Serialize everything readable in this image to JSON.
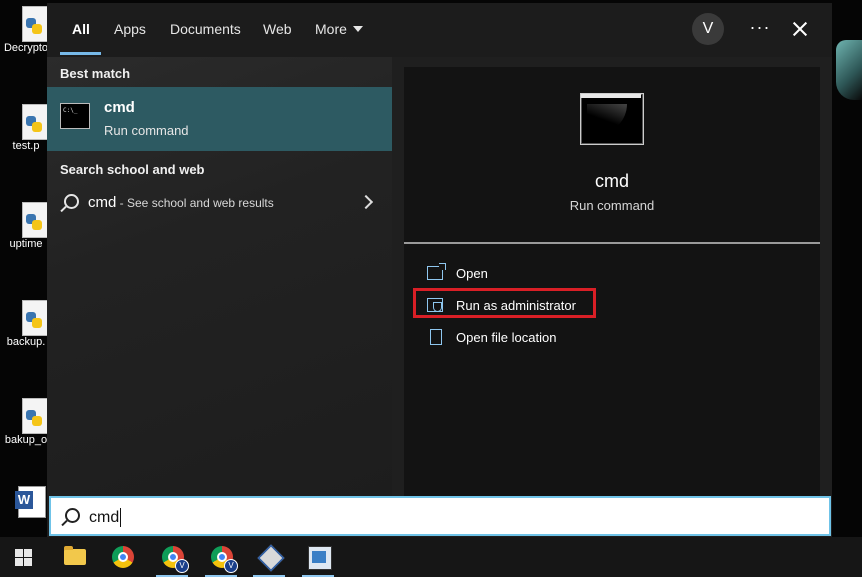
{
  "desktop": {
    "icons": [
      {
        "label": "Decrypto"
      },
      {
        "label": "test.p"
      },
      {
        "label": "uptime"
      },
      {
        "label": "backup."
      },
      {
        "label": "bakup_o"
      }
    ]
  },
  "search_panel": {
    "tabs": [
      {
        "label": "All",
        "active": true
      },
      {
        "label": "Apps"
      },
      {
        "label": "Documents"
      },
      {
        "label": "Web"
      },
      {
        "label": "More"
      }
    ],
    "user_initial": "V",
    "more_options": "···",
    "best_match": {
      "heading": "Best match",
      "title": "cmd",
      "subtitle": "Run command"
    },
    "web": {
      "heading": "Search school and web",
      "query": "cmd",
      "description": " - See school and web results"
    },
    "preview": {
      "title": "cmd",
      "subtitle": "Run command",
      "actions": [
        {
          "label": "Open"
        },
        {
          "label": "Run as administrator",
          "highlighted": true
        },
        {
          "label": "Open file location"
        }
      ]
    },
    "search_box": {
      "value": "cmd"
    }
  },
  "colors": {
    "accent": "#77b9e8",
    "selected_item": "#2d5a62",
    "highlight_box": "#d91f26"
  },
  "taskbar": {
    "apps": [
      {
        "icon": "file-explorer-icon"
      },
      {
        "icon": "chrome-icon"
      },
      {
        "icon": "chrome-profile-icon",
        "badge": "V"
      },
      {
        "icon": "chrome-profile-icon",
        "badge": "V"
      },
      {
        "icon": "virtualbox-icon"
      },
      {
        "icon": "remote-desktop-icon"
      }
    ]
  }
}
